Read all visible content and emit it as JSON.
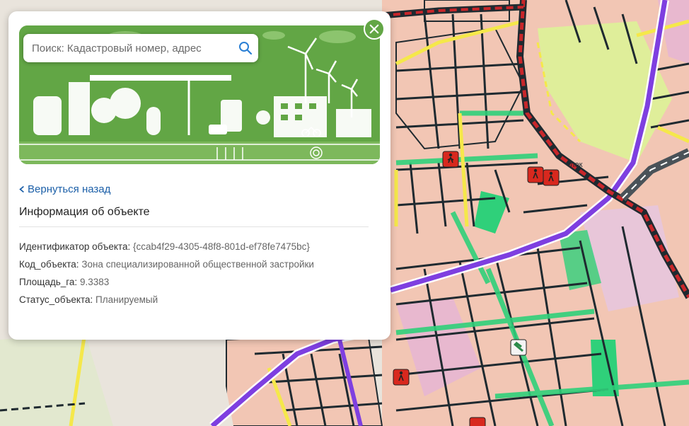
{
  "map": {
    "colors": {
      "residential": "#f2c6b4",
      "block_line": "#1f2a30",
      "green": "#b8e08a",
      "bright_green": "#2fd07a",
      "purple_road": "#7e3fe0",
      "yellow_road": "#f5e84a",
      "railway": "#c8262a",
      "pink_zone": "#e8b8cf",
      "base": "#e9e4dc"
    },
    "labels": [
      "...лок"
    ],
    "markers": [
      "pedestrian-sign-icon",
      "pedestrian-sign-icon",
      "pedestrian-sign-icon",
      "pedestrian-sign-icon",
      "ice-cream-icon",
      "pedestrian-sign-icon"
    ]
  },
  "panel": {
    "close_icon": "close-icon",
    "banner_icon": "eco-city-illustration",
    "search": {
      "placeholder": "Поиск: Кадастровый номер, адрес",
      "icon": "search-icon"
    },
    "back_label": "Вернуться назад",
    "title": "Информация об объекте",
    "attributes": [
      {
        "key": "Идентификатор объекта:",
        "value": "{ccab4f29-4305-48f8-801d-ef78fe7475bc}"
      },
      {
        "key": "Код_объекта:",
        "value": "Зона специализированной общественной застройки"
      },
      {
        "key": "Площадь_га:",
        "value": "9.3383"
      },
      {
        "key": "Статус_объекта:",
        "value": "Планируемый"
      }
    ]
  }
}
